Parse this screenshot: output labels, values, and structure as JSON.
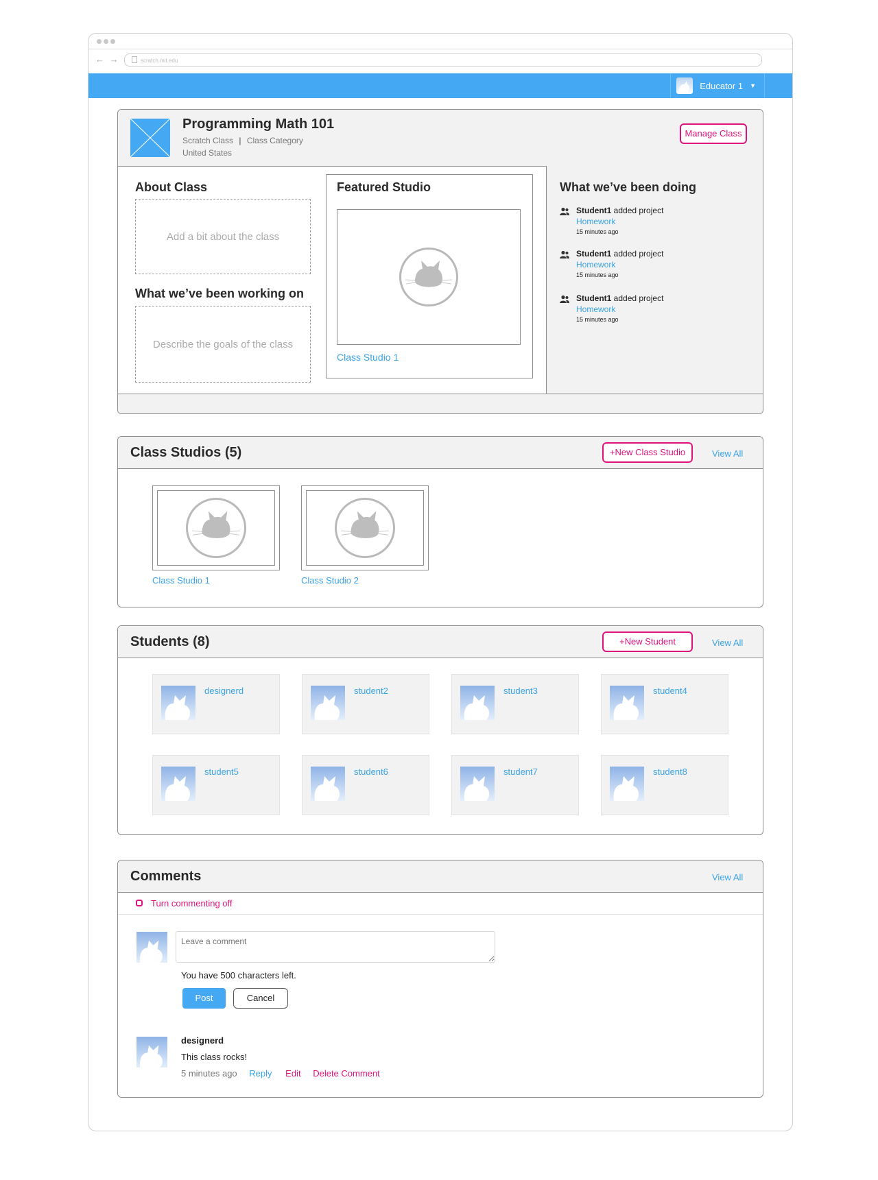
{
  "browser": {
    "url": "scratch.mit.edu",
    "nav_arrows": "← →"
  },
  "topbar": {
    "user": "Educator 1"
  },
  "classinfo": {
    "title": "Programming Math 101",
    "type": "Scratch Class",
    "separator": "|",
    "category": "Class Category",
    "country": "United States",
    "manage_label": "Manage Class"
  },
  "about": {
    "heading": "About Class",
    "placeholder": "Add a bit about the class",
    "working_heading": "What we’ve been working on",
    "working_placeholder": "Describe the goals of the class"
  },
  "featured": {
    "heading": "Featured Studio",
    "studio_name": "Class Studio 1"
  },
  "activity": {
    "heading": "What we’ve been doing",
    "items": [
      {
        "user": "Student1",
        "action": " added project",
        "project": "Homework",
        "time": "15 minutes ago"
      },
      {
        "user": "Student1",
        "action": " added project",
        "project": "Homework",
        "time": "15 minutes ago"
      },
      {
        "user": "Student1",
        "action": " added project",
        "project": "Homework",
        "time": "15 minutes ago"
      }
    ]
  },
  "studios": {
    "heading": "Class Studios (5)",
    "new_label": "+New Class Studio",
    "view_all": "View All",
    "items": [
      "Class Studio 1",
      "Class Studio 2"
    ]
  },
  "students": {
    "heading": "Students (8)",
    "new_label": "+New Student",
    "view_all": "View All",
    "items": [
      "designerd",
      "student2",
      "student3",
      "student4",
      "student5",
      "student6",
      "student7",
      "student8"
    ]
  },
  "comments": {
    "heading": "Comments",
    "view_all": "View All",
    "toggle_label": "Turn commenting off",
    "input_placeholder": "Leave a comment",
    "chars_left": "You have 500 characters left.",
    "post_label": "Post",
    "cancel_label": "Cancel",
    "items": [
      {
        "author": "designerd",
        "text": "This class rocks!",
        "time": "5 minutes ago",
        "reply": "Reply",
        "edit": "Edit",
        "delete": "Delete Comment"
      }
    ]
  },
  "colors": {
    "accent_blue": "#44a8f2",
    "link_blue": "#3aa3e6",
    "pink": "#e0127b",
    "panel_gray": "#f2f2f2"
  }
}
